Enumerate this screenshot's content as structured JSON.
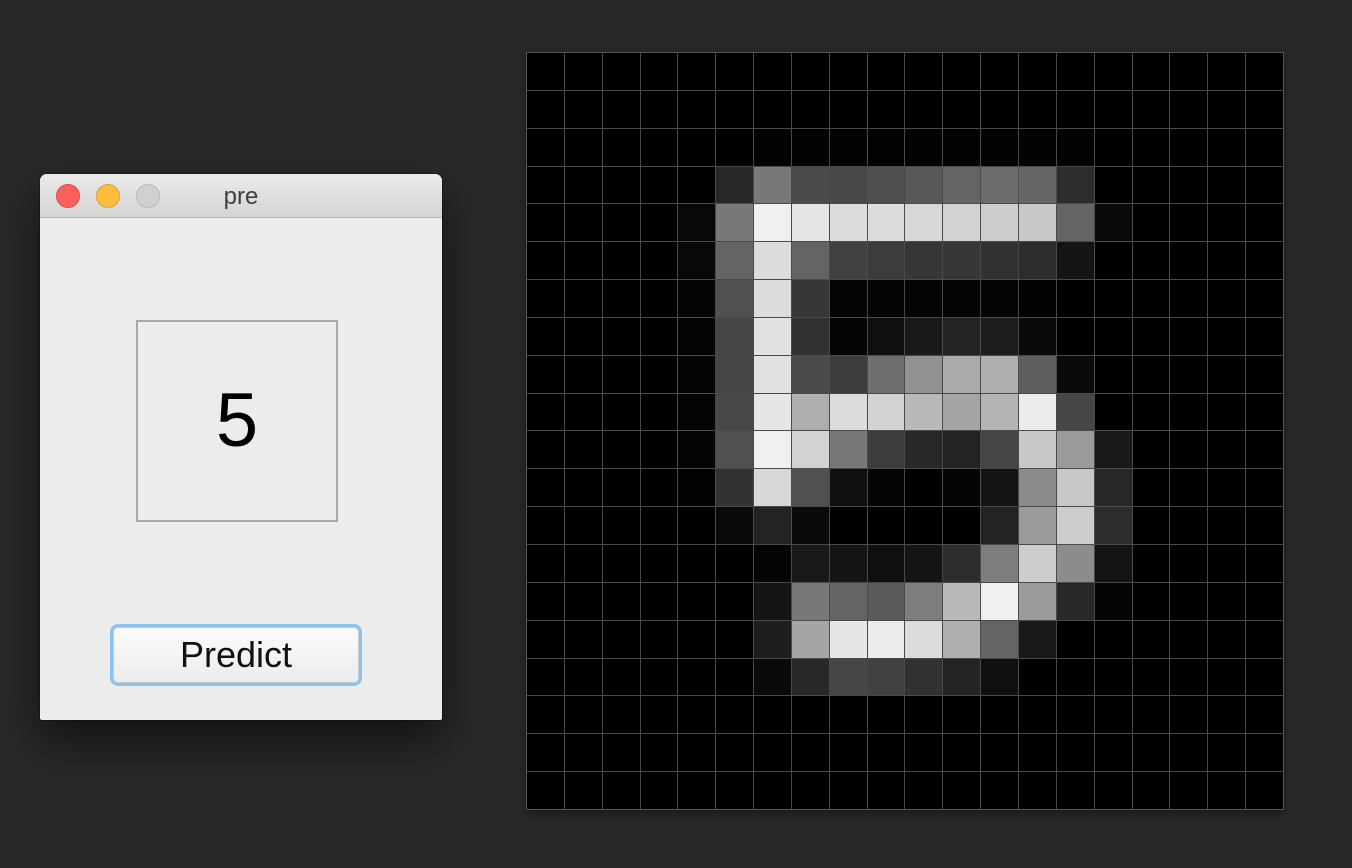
{
  "window": {
    "title": "pre"
  },
  "prediction": {
    "value": "5"
  },
  "predict_button": {
    "label": "Predict"
  },
  "grid": {
    "rows": 20,
    "cols": 20,
    "pixels": [
      [
        0,
        0,
        0,
        0,
        0,
        0,
        0,
        0,
        0,
        0,
        0,
        0,
        0,
        0,
        0,
        0,
        0,
        0,
        0,
        0
      ],
      [
        0,
        0,
        0,
        0,
        0,
        0,
        0,
        0,
        0,
        0,
        0,
        0,
        0,
        0,
        0,
        0,
        0,
        0,
        0,
        0
      ],
      [
        0,
        0,
        0,
        0,
        0,
        0,
        2,
        3,
        3,
        2,
        2,
        3,
        3,
        3,
        2,
        0,
        0,
        0,
        0,
        0
      ],
      [
        0,
        0,
        0,
        0,
        0,
        40,
        120,
        75,
        72,
        78,
        88,
        100,
        108,
        102,
        45,
        0,
        0,
        0,
        0,
        0
      ],
      [
        0,
        0,
        0,
        0,
        8,
        120,
        240,
        230,
        220,
        220,
        215,
        210,
        205,
        200,
        100,
        10,
        0,
        0,
        0,
        0
      ],
      [
        0,
        0,
        0,
        0,
        8,
        100,
        220,
        100,
        65,
        60,
        55,
        55,
        50,
        45,
        20,
        0,
        0,
        0,
        0,
        0
      ],
      [
        0,
        0,
        0,
        0,
        5,
        80,
        220,
        55,
        5,
        5,
        5,
        5,
        5,
        2,
        0,
        0,
        0,
        0,
        0,
        0
      ],
      [
        0,
        0,
        0,
        0,
        4,
        70,
        225,
        50,
        5,
        15,
        25,
        35,
        30,
        10,
        0,
        0,
        0,
        0,
        0,
        0
      ],
      [
        0,
        0,
        0,
        0,
        4,
        70,
        225,
        75,
        60,
        110,
        145,
        170,
        175,
        95,
        10,
        0,
        0,
        0,
        0,
        0
      ],
      [
        0,
        0,
        0,
        0,
        4,
        72,
        230,
        175,
        220,
        210,
        185,
        165,
        180,
        235,
        70,
        0,
        0,
        0,
        0,
        0
      ],
      [
        0,
        0,
        0,
        0,
        4,
        80,
        240,
        210,
        120,
        60,
        40,
        35,
        70,
        200,
        155,
        25,
        0,
        0,
        0,
        0
      ],
      [
        0,
        0,
        0,
        0,
        2,
        50,
        215,
        80,
        15,
        5,
        0,
        5,
        20,
        140,
        200,
        40,
        0,
        0,
        0,
        0
      ],
      [
        0,
        0,
        0,
        0,
        0,
        10,
        35,
        10,
        0,
        0,
        0,
        0,
        35,
        155,
        205,
        45,
        0,
        0,
        0,
        0
      ],
      [
        0,
        0,
        0,
        0,
        0,
        0,
        5,
        25,
        20,
        15,
        20,
        45,
        125,
        205,
        140,
        20,
        0,
        0,
        0,
        0
      ],
      [
        0,
        0,
        0,
        0,
        0,
        0,
        20,
        120,
        100,
        90,
        125,
        185,
        240,
        155,
        40,
        5,
        0,
        0,
        0,
        0
      ],
      [
        0,
        0,
        0,
        0,
        0,
        0,
        30,
        165,
        230,
        235,
        220,
        175,
        100,
        25,
        0,
        0,
        0,
        0,
        0,
        0
      ],
      [
        0,
        0,
        0,
        0,
        0,
        0,
        10,
        40,
        70,
        65,
        50,
        35,
        15,
        0,
        0,
        0,
        0,
        0,
        0,
        0
      ],
      [
        0,
        0,
        0,
        0,
        0,
        0,
        0,
        0,
        0,
        0,
        0,
        0,
        0,
        0,
        0,
        0,
        0,
        0,
        0,
        0
      ],
      [
        0,
        0,
        0,
        0,
        0,
        0,
        0,
        0,
        0,
        0,
        0,
        0,
        0,
        0,
        0,
        0,
        0,
        0,
        0,
        0
      ],
      [
        0,
        0,
        0,
        0,
        0,
        0,
        0,
        0,
        0,
        0,
        0,
        0,
        0,
        0,
        0,
        0,
        0,
        0,
        0,
        0
      ]
    ]
  }
}
